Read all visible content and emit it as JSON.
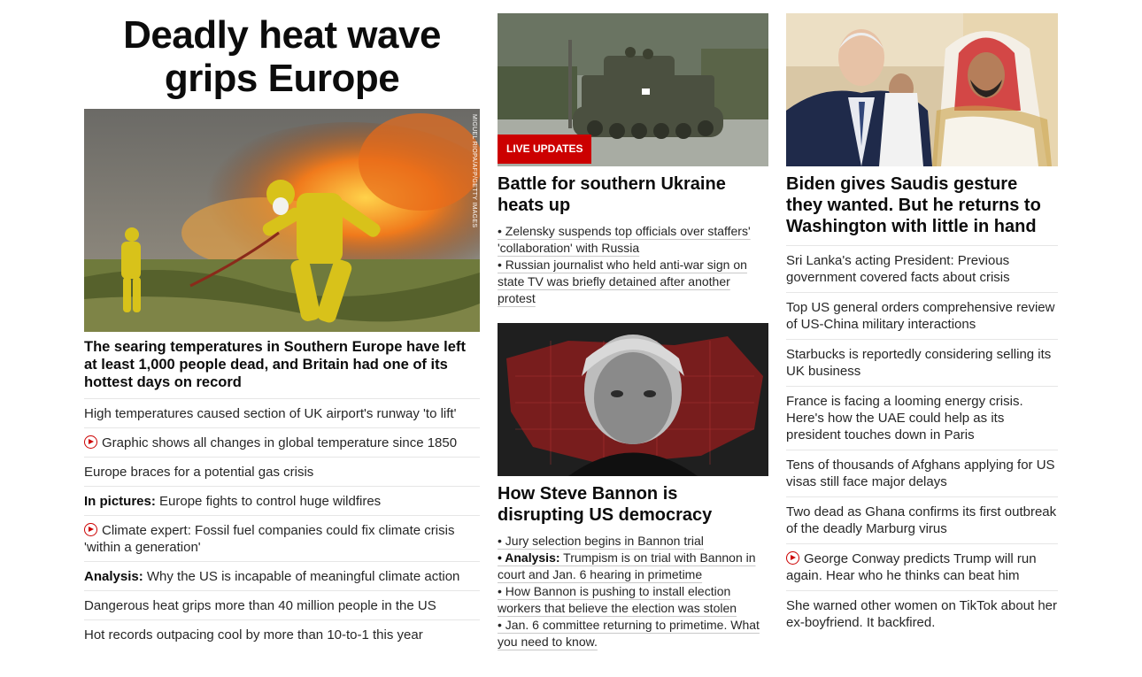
{
  "hero": {
    "title": "Deadly heat wave grips Europe",
    "image_credit": "MIGUEL RIOPA/AFP/GETTY IMAGES",
    "lead": "The searing temperatures in Southern Europe have left at least 1,000 people dead, and Britain had one of its hottest days on record"
  },
  "left_list": [
    {
      "prefix": "",
      "text": "High temperatures caused section of UK airport's runway 'to lift'",
      "video": false
    },
    {
      "prefix": "",
      "text": "Graphic shows all changes in global temperature since 1850",
      "video": true
    },
    {
      "prefix": "",
      "text": "Europe braces for a potential gas crisis",
      "video": false
    },
    {
      "prefix": "In pictures:",
      "text": " Europe fights to control huge wildfires",
      "video": false
    },
    {
      "prefix": "",
      "text": "Climate expert: Fossil fuel companies could fix climate crisis 'within a generation'",
      "video": true
    },
    {
      "prefix": "Analysis:",
      "text": " Why the US is incapable of meaningful climate action",
      "video": false
    },
    {
      "prefix": "",
      "text": "Dangerous heat grips more than 40 million people in the US",
      "video": false
    },
    {
      "prefix": "",
      "text": "Hot records outpacing cool by more than 10-to-1 this year",
      "video": false
    }
  ],
  "ukraine": {
    "badge": "LIVE UPDATES",
    "title": "Battle for southern Ukraine heats up",
    "bullets": [
      {
        "prefix": "",
        "text": "• Zelensky suspends top officials over staffers' 'collaboration' with Russia"
      },
      {
        "prefix": "",
        "text": "• Russian journalist who held anti-war sign on state TV was briefly detained after another protest"
      }
    ]
  },
  "bannon": {
    "title": "How Steve Bannon is disrupting US democracy",
    "bullets": [
      {
        "prefix": "",
        "text": "• Jury selection begins in Bannon trial"
      },
      {
        "prefix": "• Analysis:",
        "text": " Trumpism is on trial with Bannon in court and Jan. 6 hearing in primetime"
      },
      {
        "prefix": "",
        "text": "• How Bannon is pushing to install election workers that believe the election was stolen"
      },
      {
        "prefix": "",
        "text": "• Jan. 6 committee returning to primetime. What you need to know."
      }
    ]
  },
  "biden": {
    "title": "Biden gives Saudis gesture they wanted. But he returns to Washington with little in hand"
  },
  "right_list": [
    {
      "text": "Sri Lanka's acting President: Previous government covered facts about crisis",
      "video": false
    },
    {
      "text": "Top US general orders comprehensive review of US-China military interactions",
      "video": false
    },
    {
      "text": "Starbucks is reportedly considering selling its UK business",
      "video": false
    },
    {
      "text": "France is facing a looming energy crisis. Here's how the UAE could help as its president touches down in Paris",
      "video": false
    },
    {
      "text": "Tens of thousands of Afghans applying for US visas still face major delays",
      "video": false
    },
    {
      "text": "Two dead as Ghana confirms its first outbreak of the deadly Marburg virus",
      "video": false
    },
    {
      "text": "George Conway predicts Trump will run again. Hear who he thinks can beat him",
      "video": true
    },
    {
      "text": "She warned other women on TikTok about her ex-boyfriend. It backfired.",
      "video": false
    }
  ],
  "colors": {
    "accent": "#cc0000",
    "text": "#0c0c0c",
    "divider": "#e6e6e6"
  }
}
